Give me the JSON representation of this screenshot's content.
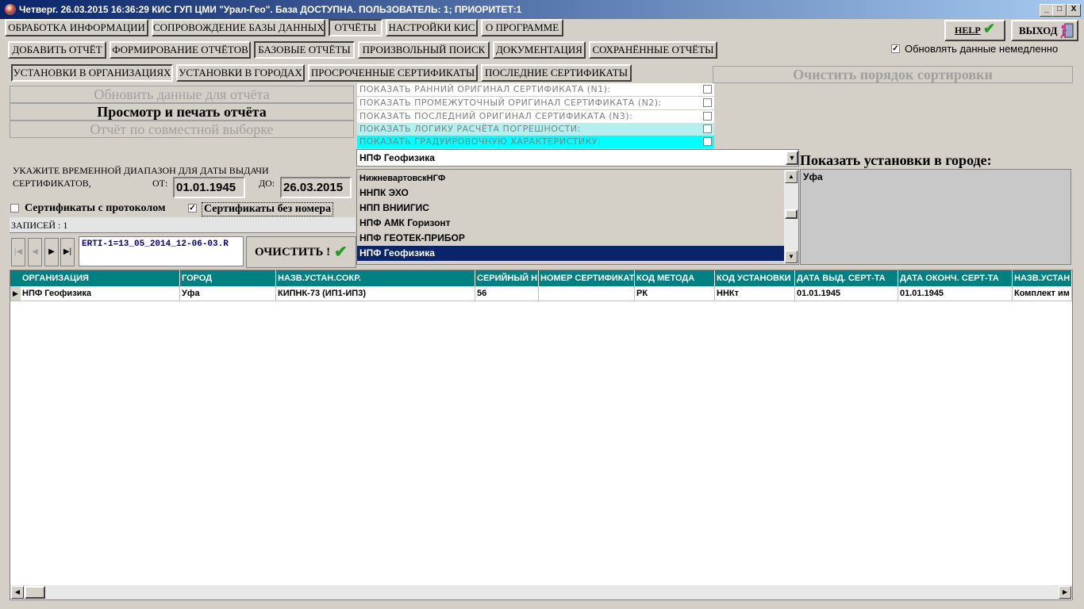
{
  "window": {
    "title": "Четверг. 26.03.2015 16:36:29 КИС ГУП ЦМИ \"Урал-Гео\". База ДОСТУПНА. ПОЛЬЗОВАТЕЛЬ: 1; ПРИОРИТЕТ:1",
    "controls": [
      "_",
      "□",
      "X"
    ]
  },
  "main_tabs": [
    "ОБРАБОТКА ИНФОРМАЦИИ",
    "СОПРОВОЖДЕНИЕ БАЗЫ ДАННЫХ",
    "ОТЧЁТЫ",
    "НАСТРОЙКИ КИС",
    "О ПРОГРАММЕ"
  ],
  "report_tabs": [
    "ДОБАВИТЬ ОТЧЁТ",
    "ФОРМИРОВАНИЕ ОТЧЁТОВ",
    "БАЗОВЫЕ ОТЧЁТЫ",
    "ПРОИЗВОЛЬНЫЙ ПОИСК",
    "ДОКУМЕНТАЦИЯ",
    "СОХРАНЁННЫЕ ОТЧЁТЫ"
  ],
  "base_tabs": [
    "УСТАНОВКИ В ОРГАНИЗАЦИЯХ",
    "УСТАНОВКИ В ГОРОДАХ",
    "ПРОСРОЧЕННЫЕ СЕРТИФИКАТЫ",
    "ПОСЛЕДНИЕ СЕРТИФИКАТЫ"
  ],
  "help_label": "HELP",
  "exit_label": "ВЫХОД",
  "auto_update": {
    "label": "Обновлять данные немедленно",
    "checked": true
  },
  "clear_sort_label": "Очистить порядок сортировки",
  "actions": {
    "refresh": "Обновить данные для отчёта",
    "preview": "Просмотр и печать отчёта",
    "joint": "Отчёт по совместной выборке"
  },
  "options": [
    {
      "label": "ПОКАЗАТЬ РАННИЙ ОРИГИНАЛ СЕРТИФИКАТА (N1):",
      "bg": "#ffffff"
    },
    {
      "label": "ПОКАЗАТЬ ПРОМЕЖУТОЧНЫЙ ОРИГИНАЛ СЕРТИФИКАТА (N2):",
      "bg": "#ffffff"
    },
    {
      "label": "ПОКАЗАТЬ ПОСЛЕДНИЙ ОРИГИНАЛ СЕРТИФИКАТА (N3):",
      "bg": "#ffffff"
    },
    {
      "label": "ПОКАЗАТЬ ЛОГИКУ РАСЧЁТА ПОГРЕШНОСТИ:",
      "bg": "#b4f0f0"
    },
    {
      "label": "ПОКАЗАТЬ ГРАДУИРОВОЧНУЮ ХАРАКТЕРИСТИКУ:",
      "bg": "#00ffff"
    }
  ],
  "date_range": {
    "caption_line1": "УКАЖИТЕ ВРЕМЕННОЙ ДИАПАЗОН ДЛЯ ДАТЫ ВЫДАЧИ",
    "caption_line2": "СЕРТИФИКАТОВ,",
    "from_label": "ОТ:",
    "from": "01.01.1945",
    "to_label": "ДО:",
    "to": "26.03.2015"
  },
  "filters": {
    "with_protocol": {
      "label": "Сертификаты с протоколом",
      "checked": false
    },
    "without_number": {
      "label": "Сертификаты без номера",
      "checked": true
    }
  },
  "records_label": "ЗАПИСЕЙ : 1",
  "search_text": "ERTI-1=13_05_2014_12-06-03.R",
  "clear_button_label": "ОЧИСТИТЬ !",
  "org_combo": "НПФ Геофизика",
  "org_list": {
    "items": [
      "НижневартовскНГФ",
      "ННПК ЭХО",
      "НПП ВНИИГИС",
      "НПФ АМК Горизонт",
      "НПФ ГЕОТЕК-ПРИБОР",
      "НПФ Геофизика"
    ],
    "selected": 5
  },
  "city_panel": {
    "title": "Показать установки в городе:",
    "items": [
      "Уфа"
    ]
  },
  "grid": {
    "columns": [
      "ОРГАНИЗАЦИЯ",
      "ГОРОД",
      "НАЗВ.УСТАН.СОКР.",
      "СЕРИЙНЫЙ Н",
      "НОМЕР СЕРТИФИКАТ",
      "КОД МЕТОДА",
      "КОД УСТАНОВКИ",
      "ДАТА ВЫД. СЕРТ-ТА",
      "ДАТА ОКОНЧ. СЕРТ-ТА",
      "НАЗВ.УСТАН"
    ],
    "rows": [
      [
        "НПФ Геофизика",
        "Уфа",
        "КИПНК-73 (ИП1-ИП3)",
        "56",
        "",
        "РК",
        "ННКт",
        "01.01.1945",
        "01.01.1945",
        "Комплект им"
      ]
    ]
  },
  "colors": {
    "header_teal": "#008080",
    "selection": "#0a246a",
    "checkmark": "#1e9e1e"
  }
}
